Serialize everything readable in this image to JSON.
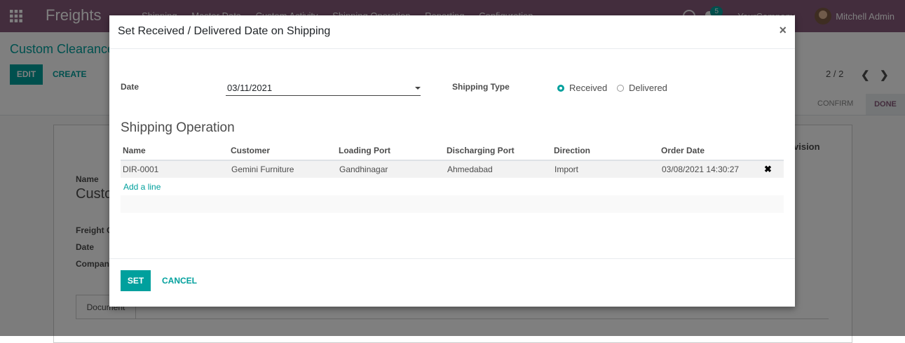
{
  "app": {
    "brand": "Freights",
    "menu": [
      "Shipping",
      "Master Data",
      "Custom Activity",
      "Shipping Operation",
      "Reporting",
      "Configuration"
    ],
    "chat_badge": "5",
    "company": "YourCompany",
    "user": "Mitchell Admin",
    "icons": {
      "apps": "apps-grid-icon",
      "clock": "clock-icon",
      "chat": "chat-icon"
    }
  },
  "control_panel": {
    "breadcrumb": "Custom Clearance",
    "edit_label": "EDIT",
    "create_label": "CREATE",
    "pager": "2 / 2",
    "prev": "❮",
    "next": "❯"
  },
  "statusbar": {
    "confirm": "CONFIRM",
    "done": "DONE"
  },
  "sheet": {
    "name_label": "Name",
    "name_value": "Custo",
    "freight_label": "Freight C",
    "date_label": "Date",
    "company_label": "Compan",
    "revision_label": "vision",
    "tab_document": "Document"
  },
  "modal": {
    "title": "Set Received / Delivered Date on Shipping",
    "close": "×",
    "date_label": "Date",
    "date_value": "03/11/2021",
    "shipping_type_label": "Shipping Type",
    "shipping_type_options": [
      "Received",
      "Delivered"
    ],
    "shipping_type_selected": "Received",
    "section_title": "Shipping Operation",
    "table": {
      "headers": [
        "Name",
        "Customer",
        "Loading Port",
        "Discharging Port",
        "Direction",
        "Order Date"
      ],
      "rows": [
        [
          "DIR-0001",
          "Gemini Furniture",
          "Gandhinagar",
          "Ahmedabad",
          "Import",
          "03/08/2021 14:30:27"
        ]
      ],
      "delete_icon": "✖",
      "add_line": "Add a line"
    },
    "set_label": "SET",
    "cancel_label": "CANCEL"
  },
  "colors": {
    "brand": "#875a7b",
    "accent": "#00a09d"
  }
}
